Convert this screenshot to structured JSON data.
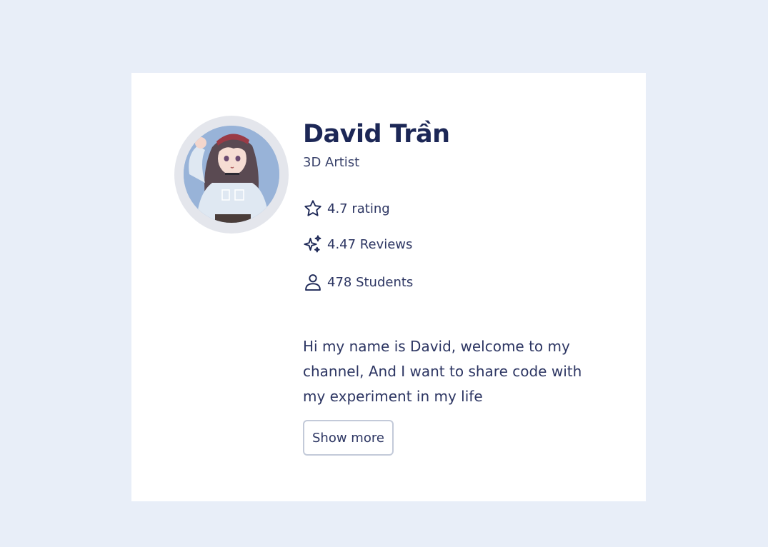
{
  "profile": {
    "name": "David Trần",
    "role": "3D Artist",
    "avatar_icon": "profile-avatar-illustration"
  },
  "stats": {
    "rating": {
      "icon": "star-icon",
      "label": "4.7 rating"
    },
    "reviews": {
      "icon": "sparkles-icon",
      "label": "4.47 Reviews"
    },
    "students": {
      "icon": "user-icon",
      "label": "478 Students"
    }
  },
  "bio": "Hi my name is David, welcome to my channel, And I want to share code with my experiment in my life",
  "actions": {
    "show_more_label": "Show more"
  },
  "colors": {
    "background": "#e8eef8",
    "card": "#ffffff",
    "text_primary": "#1c2756",
    "text_secondary": "#2c3562",
    "button_border": "#c3cad9"
  }
}
